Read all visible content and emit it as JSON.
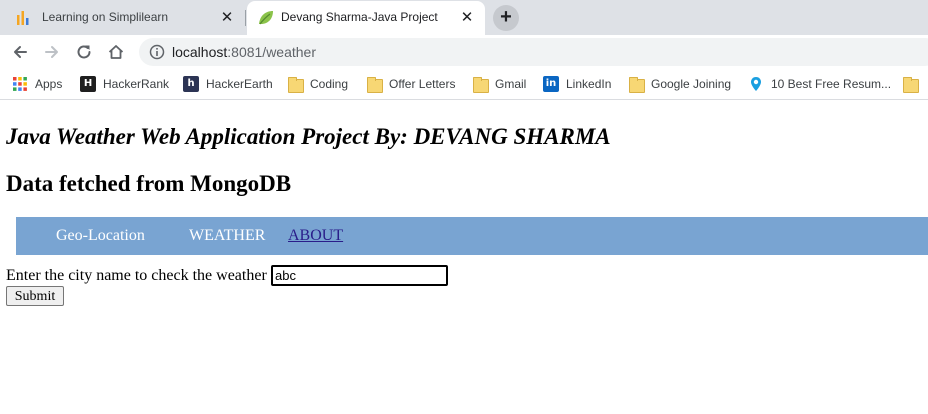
{
  "browser": {
    "tabs": [
      {
        "title": "Learning on Simplilearn",
        "active": false
      },
      {
        "title": "Devang Sharma-Java Project",
        "active": true
      }
    ],
    "new_tab_label": "+",
    "close_label": "✕",
    "address": {
      "host": "localhost",
      "rest": ":8081/weather"
    },
    "bookmarks": [
      {
        "label": "Apps",
        "icon": "apps-grid-icon"
      },
      {
        "label": "HackerRank",
        "icon": "hackerrank-icon"
      },
      {
        "label": "HackerEarth",
        "icon": "hackerearth-icon"
      },
      {
        "label": "Coding",
        "icon": "folder-icon"
      },
      {
        "label": "Offer Letters",
        "icon": "folder-icon"
      },
      {
        "label": "Gmail",
        "icon": "folder-icon"
      },
      {
        "label": "LinkedIn",
        "icon": "linkedin-icon"
      },
      {
        "label": "Google Joining",
        "icon": "folder-icon"
      },
      {
        "label": "10 Best Free Resum...",
        "icon": "location-pin-icon"
      }
    ]
  },
  "page": {
    "title": "Java Weather Web Application Project By: DEVANG SHARMA",
    "subtitle": "Data fetched from MongoDB",
    "menu": [
      {
        "label": "Geo-Location"
      },
      {
        "label": "WEATHER"
      },
      {
        "label": "ABOUT"
      }
    ],
    "form": {
      "label": "Enter the city name to check the weather",
      "city_value": "abc",
      "submit_label": "Submit"
    }
  },
  "colors": {
    "menu_bar": "#79a4d2",
    "link": "#2a1d8a",
    "tabstrip": "#dee1e6"
  }
}
